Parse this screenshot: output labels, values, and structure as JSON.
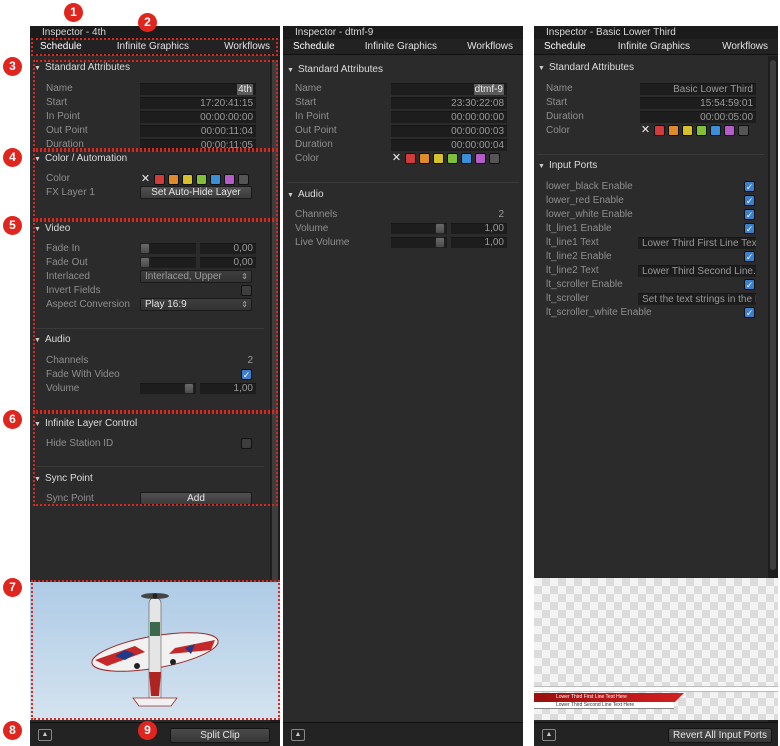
{
  "colors": {
    "callout": "#e0251f",
    "panel": "#2b2b2b",
    "swatches": [
      "#d23b3b",
      "#e08a2a",
      "#d8c02a",
      "#7fbf3a",
      "#3a8fd8",
      "#b45cc8",
      "#555555"
    ]
  },
  "callouts": [
    "1",
    "2",
    "3",
    "4",
    "5",
    "6",
    "7",
    "8",
    "9"
  ],
  "tabs": {
    "schedule": "Schedule",
    "infinite_graphics": "Infinite Graphics",
    "workflows": "Workflows"
  },
  "panel1": {
    "title": "Inspector - 4th",
    "standard": {
      "header": "Standard Attributes",
      "rows": [
        {
          "label": "Name",
          "value": "4th"
        },
        {
          "label": "Start",
          "value": "17:20:41:15"
        },
        {
          "label": "In Point",
          "value": "00:00:00:00"
        },
        {
          "label": "Out Point",
          "value": "00:00:11:04"
        },
        {
          "label": "Duration",
          "value": "00:00:11:05"
        }
      ]
    },
    "color_automation": {
      "header": "Color / Automation",
      "color_label": "Color",
      "fx_label": "FX Layer 1",
      "fx_button": "Set Auto-Hide Layer"
    },
    "video": {
      "header": "Video",
      "fade_in_label": "Fade In",
      "fade_in": "0,00",
      "fade_out_label": "Fade Out",
      "fade_out": "0,00",
      "interlaced_label": "Interlaced",
      "interlaced": "Interlaced, Upper",
      "invert_label": "Invert Fields",
      "aspect_label": "Aspect Conversion",
      "aspect": "Play 16:9"
    },
    "audio": {
      "header": "Audio",
      "channels_label": "Channels",
      "channels": "2",
      "fade_video_label": "Fade With Video",
      "volume_label": "Volume",
      "volume": "1,00"
    },
    "infinite_layer": {
      "header": "Infinite Layer Control",
      "hide_label": "Hide Station ID"
    },
    "sync": {
      "header": "Sync Point",
      "label": "Sync Point",
      "button": "Add"
    },
    "footer": {
      "split": "Split Clip"
    }
  },
  "panel2": {
    "title": "Inspector - dtmf-9",
    "standard": {
      "header": "Standard Attributes",
      "rows": [
        {
          "label": "Name",
          "value": "dtmf-9"
        },
        {
          "label": "Start",
          "value": "23:30:22:08"
        },
        {
          "label": "In Point",
          "value": "00:00:00:00"
        },
        {
          "label": "Out Point",
          "value": "00:00:00:03"
        },
        {
          "label": "Duration",
          "value": "00:00:00:04"
        }
      ],
      "color_label": "Color"
    },
    "audio": {
      "header": "Audio",
      "channels_label": "Channels",
      "channels": "2",
      "volume_label": "Volume",
      "volume": "1,00",
      "live_label": "Live Volume",
      "live": "1,00"
    }
  },
  "panel3": {
    "title": "Inspector - Basic Lower Third",
    "standard": {
      "header": "Standard Attributes",
      "rows": [
        {
          "label": "Name",
          "value": "Basic Lower Third"
        },
        {
          "label": "Start",
          "value": "15:54:59:01"
        },
        {
          "label": "Duration",
          "value": "00:00:05:00"
        }
      ],
      "color_label": "Color"
    },
    "ports": {
      "header": "Input Ports",
      "items": [
        {
          "label": "lower_black Enable",
          "type": "check"
        },
        {
          "label": "lower_red Enable",
          "type": "check"
        },
        {
          "label": "lower_white Enable",
          "type": "check"
        },
        {
          "label": "lt_line1 Enable",
          "type": "check"
        },
        {
          "label": "lt_line1 Text",
          "type": "text",
          "value": "Lower Third First Line Text..."
        },
        {
          "label": "lt_line2 Enable",
          "type": "check"
        },
        {
          "label": "lt_line2 Text",
          "type": "text",
          "value": "Lower Third Second Line..."
        },
        {
          "label": "lt_scroller Enable",
          "type": "check"
        },
        {
          "label": "lt_scroller",
          "type": "text",
          "value": "Set the text strings in the I..."
        },
        {
          "label": "lt_scroller_white Enable",
          "type": "check"
        }
      ]
    },
    "preview": {
      "line1": "Lower Third First Line Text Here",
      "line2": "Lower Third Second Line Text Here"
    },
    "footer": {
      "revert": "Revert All Input Ports"
    }
  }
}
